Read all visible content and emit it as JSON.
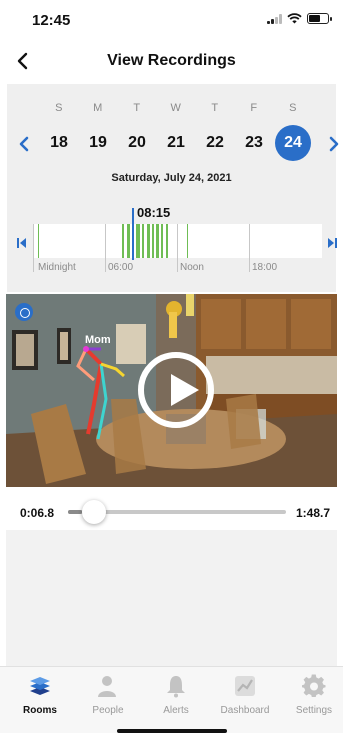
{
  "status_bar": {
    "time": "12:45"
  },
  "header": {
    "title": "View Recordings"
  },
  "calendar": {
    "weekdays": [
      "S",
      "M",
      "T",
      "W",
      "T",
      "F",
      "S"
    ],
    "days": [
      "18",
      "19",
      "20",
      "21",
      "22",
      "23",
      "24"
    ],
    "selected_day": "24",
    "date_label": "Saturday, July 24, 2021",
    "accent_color": "#2a6ec8"
  },
  "timeline": {
    "current_time": "08:15",
    "labels": [
      "Midnight",
      "06:00",
      "Noon",
      "18:00"
    ],
    "activity_color": "#6fbd55"
  },
  "video": {
    "person_label": "Mom"
  },
  "playback": {
    "elapsed": "0:06.8",
    "duration": "1:48.7",
    "progress_fraction": 0.063
  },
  "tabs": [
    {
      "label": "Rooms",
      "icon": "rooms-icon",
      "active": true
    },
    {
      "label": "People",
      "icon": "person-icon",
      "active": false
    },
    {
      "label": "Alerts",
      "icon": "bell-icon",
      "active": false
    },
    {
      "label": "Dashboard",
      "icon": "chart-icon",
      "active": false
    },
    {
      "label": "Settings",
      "icon": "gear-icon",
      "active": false
    }
  ]
}
